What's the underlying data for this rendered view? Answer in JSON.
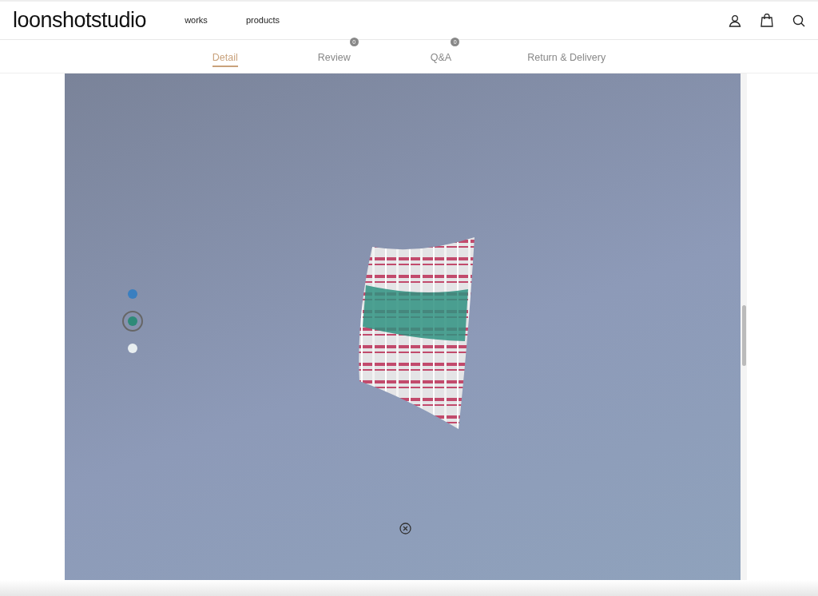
{
  "header": {
    "logo": "loonshotstudio",
    "nav": [
      "works",
      "products"
    ]
  },
  "tabs": [
    {
      "label": "Detail",
      "selected": true
    },
    {
      "label": "Review",
      "selected": false,
      "count": "0"
    },
    {
      "label": "Q&A",
      "selected": false,
      "count": "0"
    },
    {
      "label": "Return & Delivery",
      "selected": false
    }
  ],
  "viewer": {
    "swatches": [
      {
        "color": "#3a7fc0",
        "selected": false
      },
      {
        "color": "#2e8a78",
        "selected": true
      },
      {
        "color": "#e8eef0",
        "selected": false
      }
    ]
  }
}
